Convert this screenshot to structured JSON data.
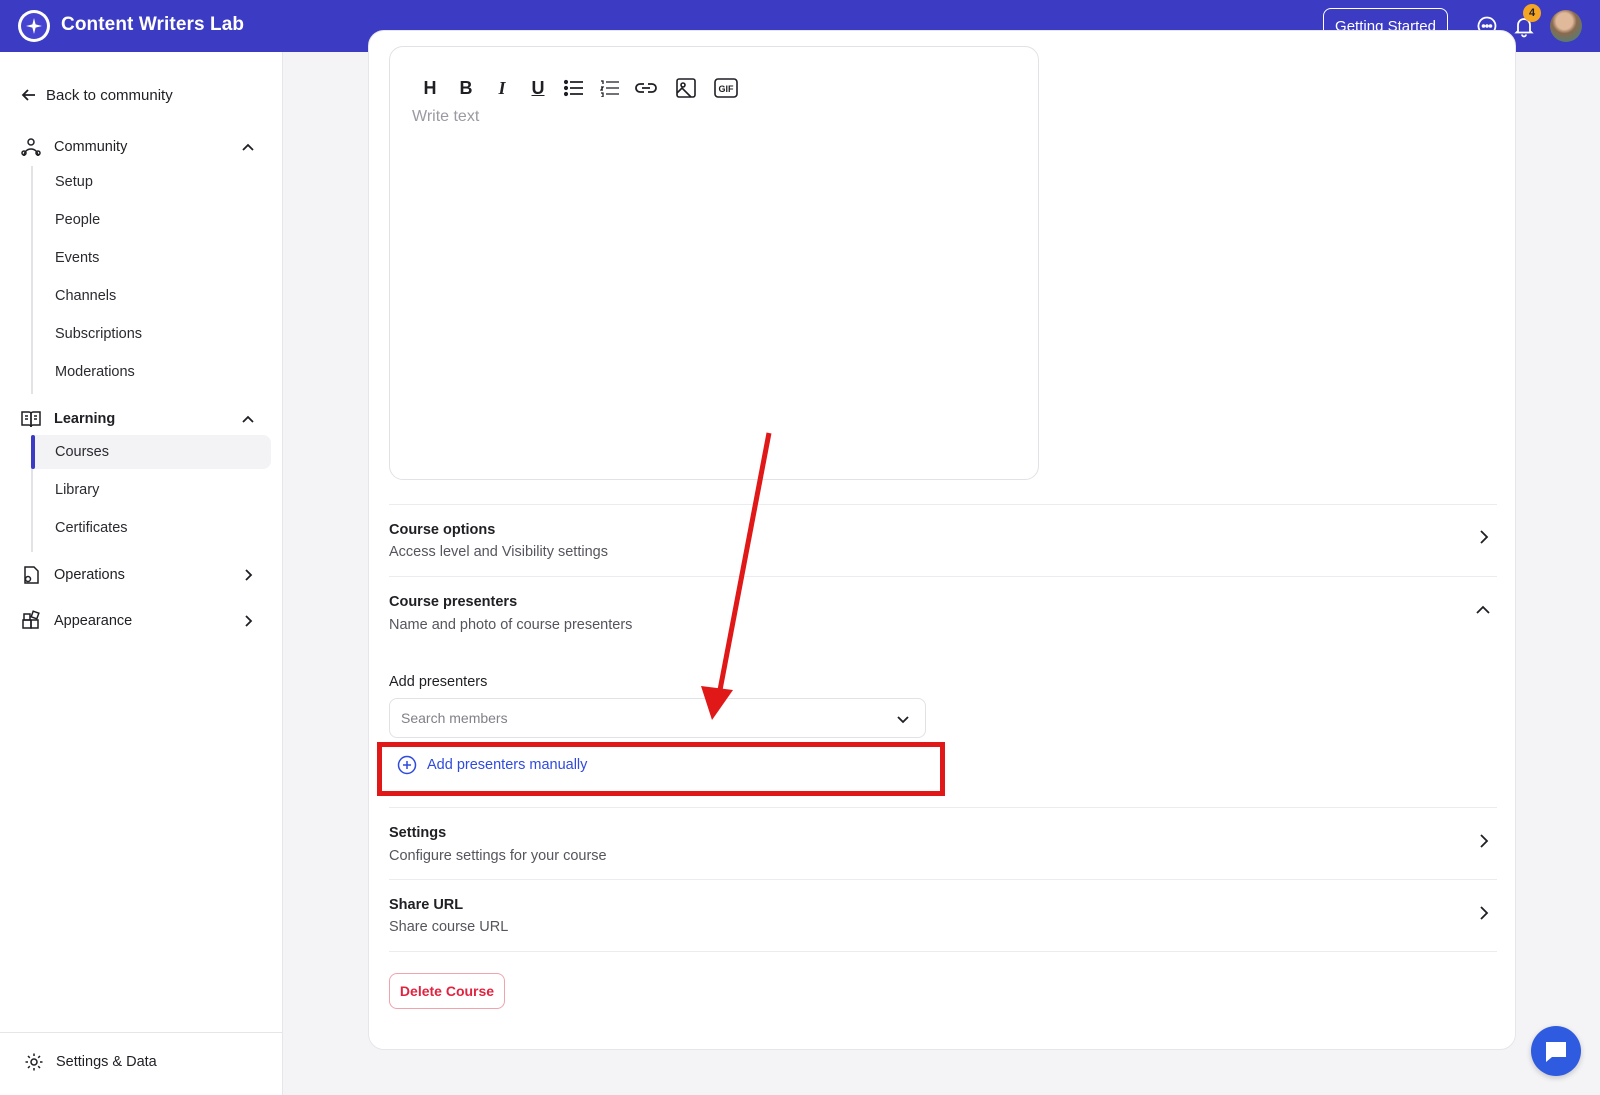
{
  "header": {
    "app_title": "Content Writers Lab",
    "getting_started_label": "Getting Started",
    "notification_count": "4",
    "colors": {
      "bar": "#3c3bc4"
    }
  },
  "sidebar": {
    "back_label": "Back to community",
    "community": {
      "label": "Community",
      "items": [
        "Setup",
        "People",
        "Events",
        "Channels",
        "Subscriptions",
        "Moderations"
      ]
    },
    "learning": {
      "label": "Learning",
      "items": [
        "Courses",
        "Library",
        "Certificates"
      ],
      "active_item": "Courses"
    },
    "operations_label": "Operations",
    "appearance_label": "Appearance",
    "settings_label": "Settings & Data"
  },
  "editor": {
    "placeholder": "Write text",
    "toolbar": [
      {
        "icon": "heading-icon",
        "glyph": "H"
      },
      {
        "icon": "bold-icon",
        "glyph": "B"
      },
      {
        "icon": "italic-icon",
        "glyph": "I"
      },
      {
        "icon": "underline-icon",
        "glyph": "U"
      },
      {
        "icon": "bullet-list-icon"
      },
      {
        "icon": "numbered-list-icon"
      },
      {
        "icon": "link-icon"
      },
      {
        "icon": "image-icon"
      },
      {
        "icon": "gif-icon",
        "glyph": "GIF"
      }
    ]
  },
  "course_options": {
    "title": "Course options",
    "subtitle": "Access level and Visibility settings"
  },
  "course_presenters": {
    "title": "Course presenters",
    "subtitle": "Name and photo of course presenters",
    "add_label": "Add presenters",
    "search_placeholder": "Search members",
    "add_manual_label": "Add presenters manually"
  },
  "settings": {
    "title": "Settings",
    "subtitle": "Configure settings for your course"
  },
  "share_url": {
    "title": "Share URL",
    "subtitle": "Share course URL"
  },
  "delete_label": "Delete Course",
  "annotation_color": "#e01818"
}
